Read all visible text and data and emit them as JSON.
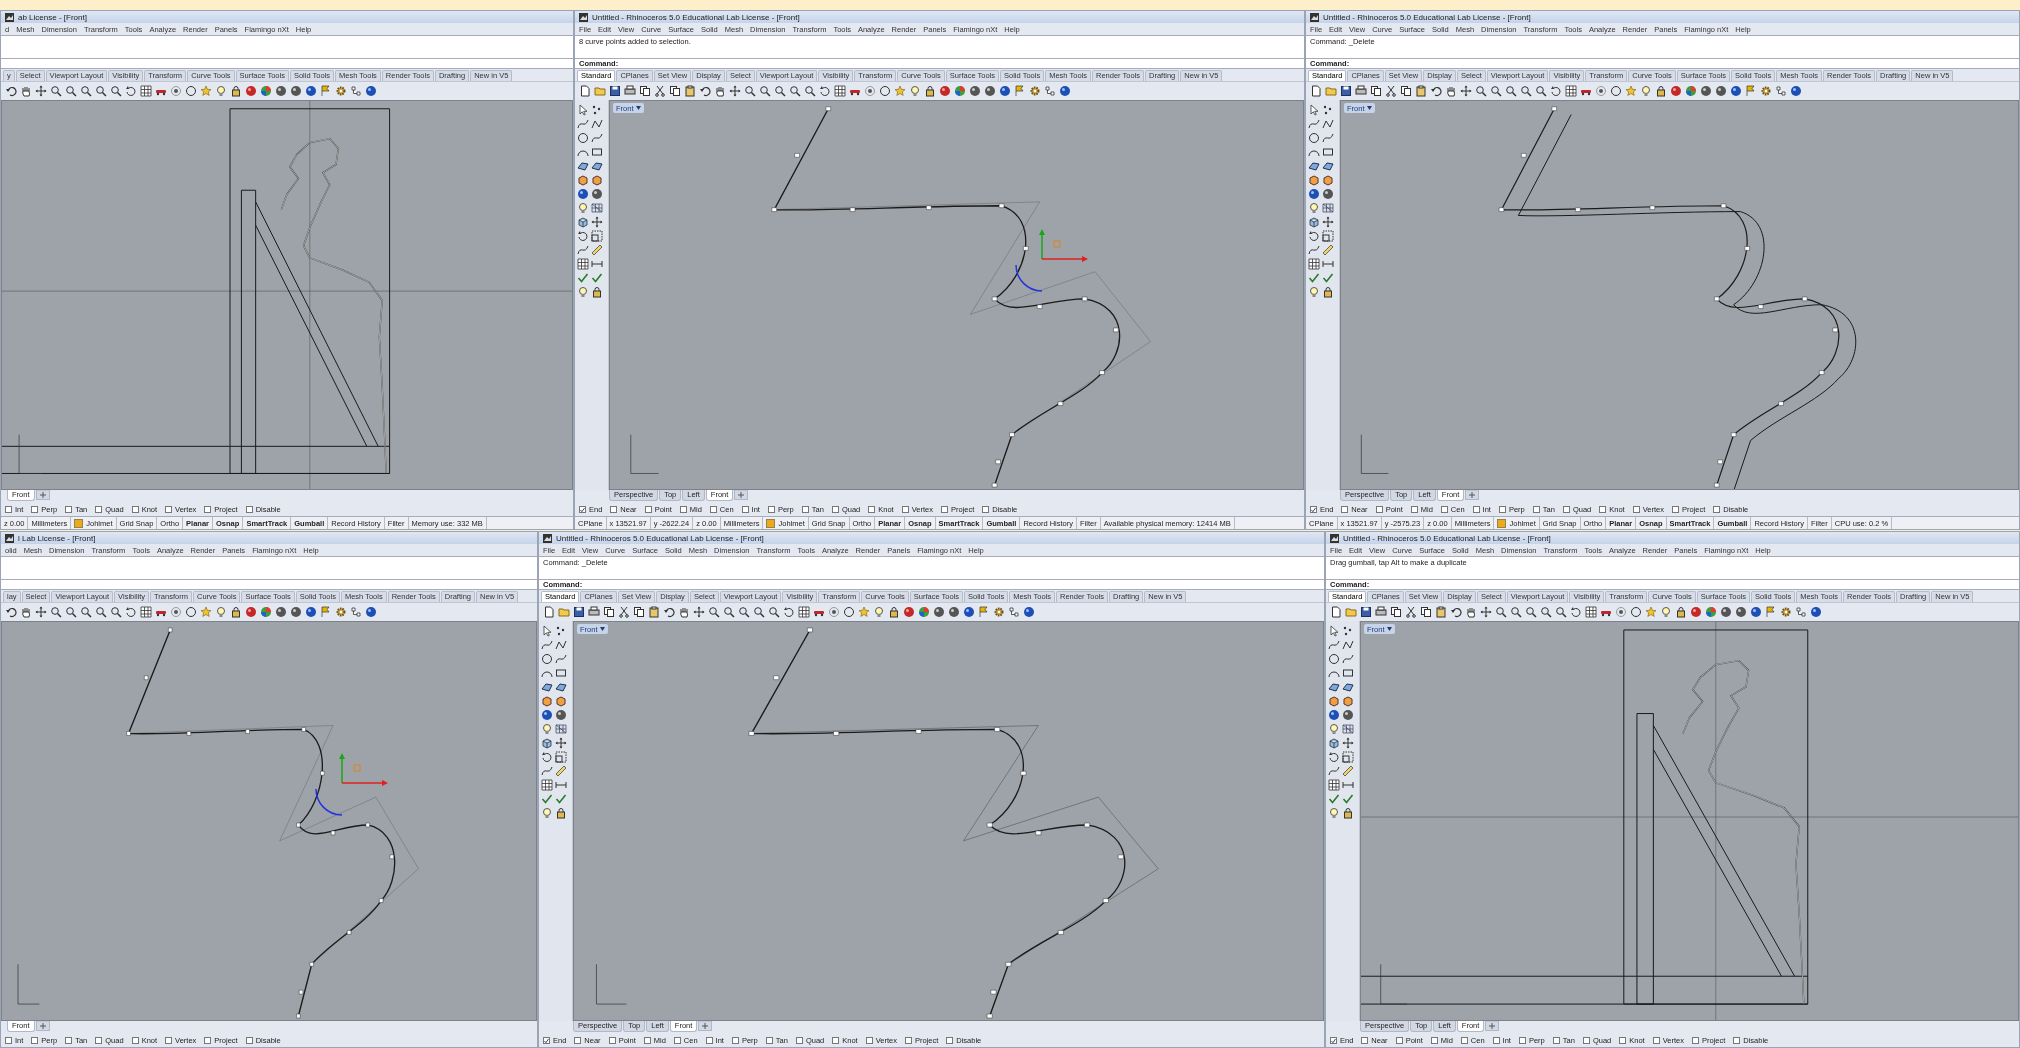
{
  "windows": [
    {
      "title": "ab License - [Front]",
      "menu": [
        "d",
        "Mesh",
        "Dimension",
        "Transform",
        "Tools",
        "Analyze",
        "Render",
        "Panels",
        "Flamingo nXt",
        "Help"
      ],
      "side_toolbar": false,
      "toolbar_tabs": [
        {
          "label": "y",
          "selected": false
        },
        {
          "label": "Select",
          "selected": false
        },
        {
          "label": "Viewport Layout",
          "selected": false
        },
        {
          "label": "Visibility",
          "selected": false
        },
        {
          "label": "Transform",
          "selected": false
        },
        {
          "label": "Curve Tools",
          "selected": false
        },
        {
          "label": "Surface Tools",
          "selected": false
        },
        {
          "label": "Solid Tools",
          "selected": false
        },
        {
          "label": "Mesh Tools",
          "selected": false
        },
        {
          "label": "Render Tools",
          "selected": false
        },
        {
          "label": "Drafting",
          "selected": false
        },
        {
          "label": "New in V5",
          "selected": false
        }
      ],
      "viewport": {
        "kind": "frame"
      },
      "view_tabs": [
        {
          "label": "Front",
          "selected": true
        }
      ],
      "osnaps": [
        {
          "label": "Int",
          "checked": false
        },
        {
          "label": "Perp",
          "checked": false
        },
        {
          "label": "Tan",
          "checked": false
        },
        {
          "label": "Quad",
          "checked": false
        },
        {
          "label": "Knot",
          "checked": false
        },
        {
          "label": "Vertex",
          "checked": false
        },
        {
          "label": "Project",
          "checked": false
        },
        {
          "label": "Disable",
          "checked": false
        }
      ],
      "status_bar": [
        {
          "kind": "text",
          "text": "z 0.00"
        },
        {
          "kind": "text",
          "text": "Millimeters"
        },
        {
          "kind": "layer",
          "text": "Johlmet"
        },
        {
          "kind": "toggle",
          "text": "Grid Snap",
          "on": false
        },
        {
          "kind": "toggle",
          "text": "Ortho",
          "on": false
        },
        {
          "kind": "toggle",
          "text": "Planar",
          "on": true
        },
        {
          "kind": "toggle",
          "text": "Osnap",
          "on": true
        },
        {
          "kind": "toggle",
          "text": "SmartTrack",
          "on": true
        },
        {
          "kind": "toggle",
          "text": "Gumball",
          "on": true
        },
        {
          "kind": "toggle",
          "text": "Record History",
          "on": false
        },
        {
          "kind": "toggle",
          "text": "Filter",
          "on": false
        },
        {
          "kind": "text",
          "text": "Memory use: 332 MB"
        }
      ]
    },
    {
      "title": "Untitled - Rhinoceros 5.0 Educational Lab License - [Front]",
      "menu": [
        "File",
        "Edit",
        "View",
        "Curve",
        "Surface",
        "Solid",
        "Mesh",
        "Dimension",
        "Transform",
        "Tools",
        "Analyze",
        "Render",
        "Panels",
        "Flamingo nXt",
        "Help"
      ],
      "command_history": "8 curve points added to selection.",
      "command_prompt": "Command:",
      "side_toolbar": true,
      "toolbar_tabs": [
        {
          "label": "Standard",
          "selected": true
        },
        {
          "label": "CPlanes",
          "selected": false
        },
        {
          "label": "Set View",
          "selected": false
        },
        {
          "label": "Display",
          "selected": false
        },
        {
          "label": "Select",
          "selected": false
        },
        {
          "label": "Viewport Layout",
          "selected": false
        },
        {
          "label": "Visibility",
          "selected": false
        },
        {
          "label": "Transform",
          "selected": false
        },
        {
          "label": "Curve Tools",
          "selected": false
        },
        {
          "label": "Surface Tools",
          "selected": false
        },
        {
          "label": "Solid Tools",
          "selected": false
        },
        {
          "label": "Mesh Tools",
          "selected": false
        },
        {
          "label": "Render Tools",
          "selected": false
        },
        {
          "label": "Drafting",
          "selected": false
        },
        {
          "label": "New in V5",
          "selected": false
        }
      ],
      "viewport": {
        "label": "Front",
        "kind": "curve-gumball"
      },
      "view_tabs": [
        {
          "label": "Perspective",
          "selected": false
        },
        {
          "label": "Top",
          "selected": false
        },
        {
          "label": "Left",
          "selected": false
        },
        {
          "label": "Front",
          "selected": true
        }
      ],
      "osnaps": [
        {
          "label": "End",
          "checked": true
        },
        {
          "label": "Near",
          "checked": false
        },
        {
          "label": "Point",
          "checked": false
        },
        {
          "label": "Mid",
          "checked": false
        },
        {
          "label": "Cen",
          "checked": false
        },
        {
          "label": "Int",
          "checked": false
        },
        {
          "label": "Perp",
          "checked": false
        },
        {
          "label": "Tan",
          "checked": false
        },
        {
          "label": "Quad",
          "checked": false
        },
        {
          "label": "Knot",
          "checked": false
        },
        {
          "label": "Vertex",
          "checked": false
        },
        {
          "label": "Project",
          "checked": false
        },
        {
          "label": "Disable",
          "checked": false
        }
      ],
      "status_bar": [
        {
          "kind": "text",
          "text": "CPlane"
        },
        {
          "kind": "text",
          "text": "x 13521.97"
        },
        {
          "kind": "text",
          "text": "y -2622.24"
        },
        {
          "kind": "text",
          "text": "z 0.00"
        },
        {
          "kind": "text",
          "text": "Millimeters"
        },
        {
          "kind": "layer",
          "text": "Johlmet"
        },
        {
          "kind": "toggle",
          "text": "Grid Snap",
          "on": false
        },
        {
          "kind": "toggle",
          "text": "Ortho",
          "on": false
        },
        {
          "kind": "toggle",
          "text": "Planar",
          "on": true
        },
        {
          "kind": "toggle",
          "text": "Osnap",
          "on": true
        },
        {
          "kind": "toggle",
          "text": "SmartTrack",
          "on": true
        },
        {
          "kind": "toggle",
          "text": "Gumball",
          "on": true
        },
        {
          "kind": "toggle",
          "text": "Record History",
          "on": false
        },
        {
          "kind": "toggle",
          "text": "Filter",
          "on": false
        },
        {
          "kind": "text",
          "text": "Available physical memory: 12414 MB"
        }
      ]
    },
    {
      "title": "Untitled - Rhinoceros 5.0 Educational Lab License - [Front]",
      "menu": [
        "File",
        "Edit",
        "View",
        "Curve",
        "Surface",
        "Solid",
        "Mesh",
        "Dimension",
        "Transform",
        "Tools",
        "Analyze",
        "Render",
        "Panels",
        "Flamingo nXt",
        "Help"
      ],
      "command_history": "Command: _Delete",
      "command_prompt": "Command:",
      "side_toolbar": true,
      "toolbar_tabs": [
        {
          "label": "Standard",
          "selected": true
        },
        {
          "label": "CPlanes",
          "selected": false
        },
        {
          "label": "Set View",
          "selected": false
        },
        {
          "label": "Display",
          "selected": false
        },
        {
          "label": "Select",
          "selected": false
        },
        {
          "label": "Viewport Layout",
          "selected": false
        },
        {
          "label": "Visibility",
          "selected": false
        },
        {
          "label": "Transform",
          "selected": false
        },
        {
          "label": "Curve Tools",
          "selected": false
        },
        {
          "label": "Surface Tools",
          "selected": false
        },
        {
          "label": "Solid Tools",
          "selected": false
        },
        {
          "label": "Mesh Tools",
          "selected": false
        },
        {
          "label": "Render Tools",
          "selected": false
        },
        {
          "label": "Drafting",
          "selected": false
        },
        {
          "label": "New in V5",
          "selected": false
        }
      ],
      "viewport": {
        "label": "Front",
        "kind": "curve-offset"
      },
      "view_tabs": [
        {
          "label": "Perspective",
          "selected": false
        },
        {
          "label": "Top",
          "selected": false
        },
        {
          "label": "Left",
          "selected": false
        },
        {
          "label": "Front",
          "selected": true
        }
      ],
      "osnaps": [
        {
          "label": "End",
          "checked": true
        },
        {
          "label": "Near",
          "checked": false
        },
        {
          "label": "Point",
          "checked": false
        },
        {
          "label": "Mid",
          "checked": false
        },
        {
          "label": "Cen",
          "checked": false
        },
        {
          "label": "Int",
          "checked": false
        },
        {
          "label": "Perp",
          "checked": false
        },
        {
          "label": "Tan",
          "checked": false
        },
        {
          "label": "Quad",
          "checked": false
        },
        {
          "label": "Knot",
          "checked": false
        },
        {
          "label": "Vertex",
          "checked": false
        },
        {
          "label": "Project",
          "checked": false
        },
        {
          "label": "Disable",
          "checked": false
        }
      ],
      "status_bar": [
        {
          "kind": "text",
          "text": "CPlane"
        },
        {
          "kind": "text",
          "text": "x 13521.97"
        },
        {
          "kind": "text",
          "text": "y -2575.23"
        },
        {
          "kind": "text",
          "text": "z 0.00"
        },
        {
          "kind": "text",
          "text": "Millimeters"
        },
        {
          "kind": "layer",
          "text": "Johlmet"
        },
        {
          "kind": "toggle",
          "text": "Grid Snap",
          "on": false
        },
        {
          "kind": "toggle",
          "text": "Ortho",
          "on": false
        },
        {
          "kind": "toggle",
          "text": "Planar",
          "on": true
        },
        {
          "kind": "toggle",
          "text": "Osnap",
          "on": true
        },
        {
          "kind": "toggle",
          "text": "SmartTrack",
          "on": true
        },
        {
          "kind": "toggle",
          "text": "Gumball",
          "on": true
        },
        {
          "kind": "toggle",
          "text": "Record History",
          "on": false
        },
        {
          "kind": "toggle",
          "text": "Filter",
          "on": false
        },
        {
          "kind": "text",
          "text": "CPU use: 0.2 %"
        }
      ]
    },
    {
      "title": "l Lab License - [Front]",
      "menu": [
        "olid",
        "Mesh",
        "Dimension",
        "Transform",
        "Tools",
        "Analyze",
        "Render",
        "Panels",
        "Flamingo nXt",
        "Help"
      ],
      "side_toolbar": false,
      "toolbar_tabs": [
        {
          "label": "lay",
          "selected": false
        },
        {
          "label": "Select",
          "selected": false
        },
        {
          "label": "Viewport Layout",
          "selected": false
        },
        {
          "label": "Visibility",
          "selected": false
        },
        {
          "label": "Transform",
          "selected": false
        },
        {
          "label": "Curve Tools",
          "selected": false
        },
        {
          "label": "Surface Tools",
          "selected": false
        },
        {
          "label": "Solid Tools",
          "selected": false
        },
        {
          "label": "Mesh Tools",
          "selected": false
        },
        {
          "label": "Render Tools",
          "selected": false
        },
        {
          "label": "Drafting",
          "selected": false
        },
        {
          "label": "New in V5",
          "selected": false
        }
      ],
      "viewport": {
        "kind": "curve-gumball"
      },
      "view_tabs": [
        {
          "label": "Front",
          "selected": true
        }
      ],
      "osnaps": [
        {
          "label": "Int",
          "checked": false
        },
        {
          "label": "Perp",
          "checked": false
        },
        {
          "label": "Tan",
          "checked": false
        },
        {
          "label": "Quad",
          "checked": false
        },
        {
          "label": "Knot",
          "checked": false
        },
        {
          "label": "Vertex",
          "checked": false
        },
        {
          "label": "Project",
          "checked": false
        },
        {
          "label": "Disable",
          "checked": false
        }
      ]
    },
    {
      "title": "Untitled - Rhinoceros 5.0 Educational Lab License - [Front]",
      "menu": [
        "File",
        "Edit",
        "View",
        "Curve",
        "Surface",
        "Solid",
        "Mesh",
        "Dimension",
        "Transform",
        "Tools",
        "Analyze",
        "Render",
        "Panels",
        "Flamingo nXt",
        "Help"
      ],
      "command_history": "Command: _Delete",
      "command_prompt": "Command:",
      "side_toolbar": true,
      "toolbar_tabs": [
        {
          "label": "Standard",
          "selected": true
        },
        {
          "label": "CPlanes",
          "selected": false
        },
        {
          "label": "Set View",
          "selected": false
        },
        {
          "label": "Display",
          "selected": false
        },
        {
          "label": "Select",
          "selected": false
        },
        {
          "label": "Viewport Layout",
          "selected": false
        },
        {
          "label": "Visibility",
          "selected": false
        },
        {
          "label": "Transform",
          "selected": false
        },
        {
          "label": "Curve Tools",
          "selected": false
        },
        {
          "label": "Surface Tools",
          "selected": false
        },
        {
          "label": "Solid Tools",
          "selected": false
        },
        {
          "label": "Mesh Tools",
          "selected": false
        },
        {
          "label": "Render Tools",
          "selected": false
        },
        {
          "label": "Drafting",
          "selected": false
        },
        {
          "label": "New in V5",
          "selected": false
        }
      ],
      "viewport": {
        "label": "Front",
        "kind": "curve-control"
      },
      "view_tabs": [
        {
          "label": "Perspective",
          "selected": false
        },
        {
          "label": "Top",
          "selected": false
        },
        {
          "label": "Left",
          "selected": false
        },
        {
          "label": "Front",
          "selected": true
        }
      ],
      "osnaps": [
        {
          "label": "End",
          "checked": true
        },
        {
          "label": "Near",
          "checked": false
        },
        {
          "label": "Point",
          "checked": false
        },
        {
          "label": "Mid",
          "checked": false
        },
        {
          "label": "Cen",
          "checked": false
        },
        {
          "label": "Int",
          "checked": false
        },
        {
          "label": "Perp",
          "checked": false
        },
        {
          "label": "Tan",
          "checked": false
        },
        {
          "label": "Quad",
          "checked": false
        },
        {
          "label": "Knot",
          "checked": false
        },
        {
          "label": "Vertex",
          "checked": false
        },
        {
          "label": "Project",
          "checked": false
        },
        {
          "label": "Disable",
          "checked": false
        }
      ]
    },
    {
      "title": "Untitled - Rhinoceros 5.0 Educational Lab License - [Front]",
      "menu": [
        "File",
        "Edit",
        "View",
        "Curve",
        "Surface",
        "Solid",
        "Mesh",
        "Dimension",
        "Transform",
        "Tools",
        "Analyze",
        "Render",
        "Panels",
        "Flamingo nXt",
        "Help"
      ],
      "command_history": "Drag gumball, tap Alt to make a duplicate",
      "command_prompt": "Command:",
      "side_toolbar": true,
      "toolbar_tabs": [
        {
          "label": "Standard",
          "selected": true
        },
        {
          "label": "CPlanes",
          "selected": false
        },
        {
          "label": "Set View",
          "selected": false
        },
        {
          "label": "Display",
          "selected": false
        },
        {
          "label": "Select",
          "selected": false
        },
        {
          "label": "Viewport Layout",
          "selected": false
        },
        {
          "label": "Visibility",
          "selected": false
        },
        {
          "label": "Transform",
          "selected": false
        },
        {
          "label": "Curve Tools",
          "selected": false
        },
        {
          "label": "Surface Tools",
          "selected": false
        },
        {
          "label": "Solid Tools",
          "selected": false
        },
        {
          "label": "Mesh Tools",
          "selected": false
        },
        {
          "label": "Render Tools",
          "selected": false
        },
        {
          "label": "Drafting",
          "selected": false
        },
        {
          "label": "New in V5",
          "selected": false
        }
      ],
      "viewport": {
        "label": "Front",
        "kind": "frame"
      },
      "view_tabs": [
        {
          "label": "Perspective",
          "selected": false
        },
        {
          "label": "Top",
          "selected": false
        },
        {
          "label": "Left",
          "selected": false
        },
        {
          "label": "Front",
          "selected": true
        }
      ],
      "osnaps": [
        {
          "label": "End",
          "checked": true
        },
        {
          "label": "Near",
          "checked": false
        },
        {
          "label": "Point",
          "checked": false
        },
        {
          "label": "Mid",
          "checked": false
        },
        {
          "label": "Cen",
          "checked": false
        },
        {
          "label": "Int",
          "checked": false
        },
        {
          "label": "Perp",
          "checked": false
        },
        {
          "label": "Tan",
          "checked": false
        },
        {
          "label": "Quad",
          "checked": false
        },
        {
          "label": "Knot",
          "checked": false
        },
        {
          "label": "Vertex",
          "checked": false
        },
        {
          "label": "Project",
          "checked": false
        },
        {
          "label": "Disable",
          "checked": false
        }
      ]
    }
  ]
}
